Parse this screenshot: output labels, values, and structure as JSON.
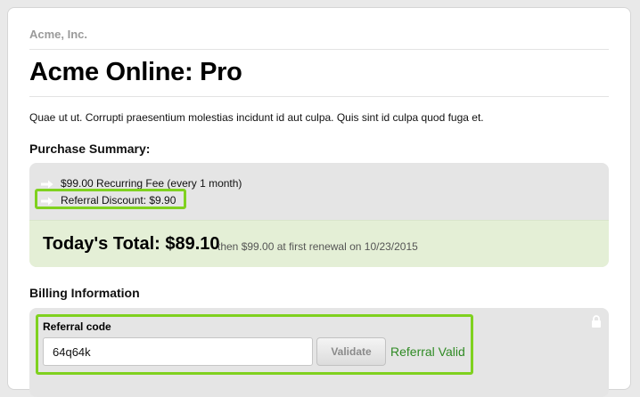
{
  "company": {
    "name": "Acme, Inc."
  },
  "product": {
    "title": "Acme Online: Pro",
    "description": "Quae ut ut. Corrupti praesentium molestias incidunt id aut culpa. Quis sint id culpa quod fuga et."
  },
  "purchase_summary": {
    "heading": "Purchase Summary:",
    "items": [
      {
        "text": "$99.00 Recurring Fee (every 1 month)",
        "icon": "arrow-right-icon"
      },
      {
        "text": "Referral Discount: $9.90",
        "icon": "arrow-right-icon"
      }
    ],
    "total_label": "Today's Total: $89.10",
    "total_note": "then $99.00 at first renewal on 10/23/2015"
  },
  "billing": {
    "heading": "Billing Information",
    "referral": {
      "label": "Referral code",
      "value": "64q64k",
      "validate_label": "Validate",
      "status": "Referral Valid"
    },
    "lock_icon": "lock-icon"
  },
  "colors": {
    "highlight": "#7fd11f",
    "total_background": "#e4efd6",
    "status_valid": "#2f8a24"
  }
}
